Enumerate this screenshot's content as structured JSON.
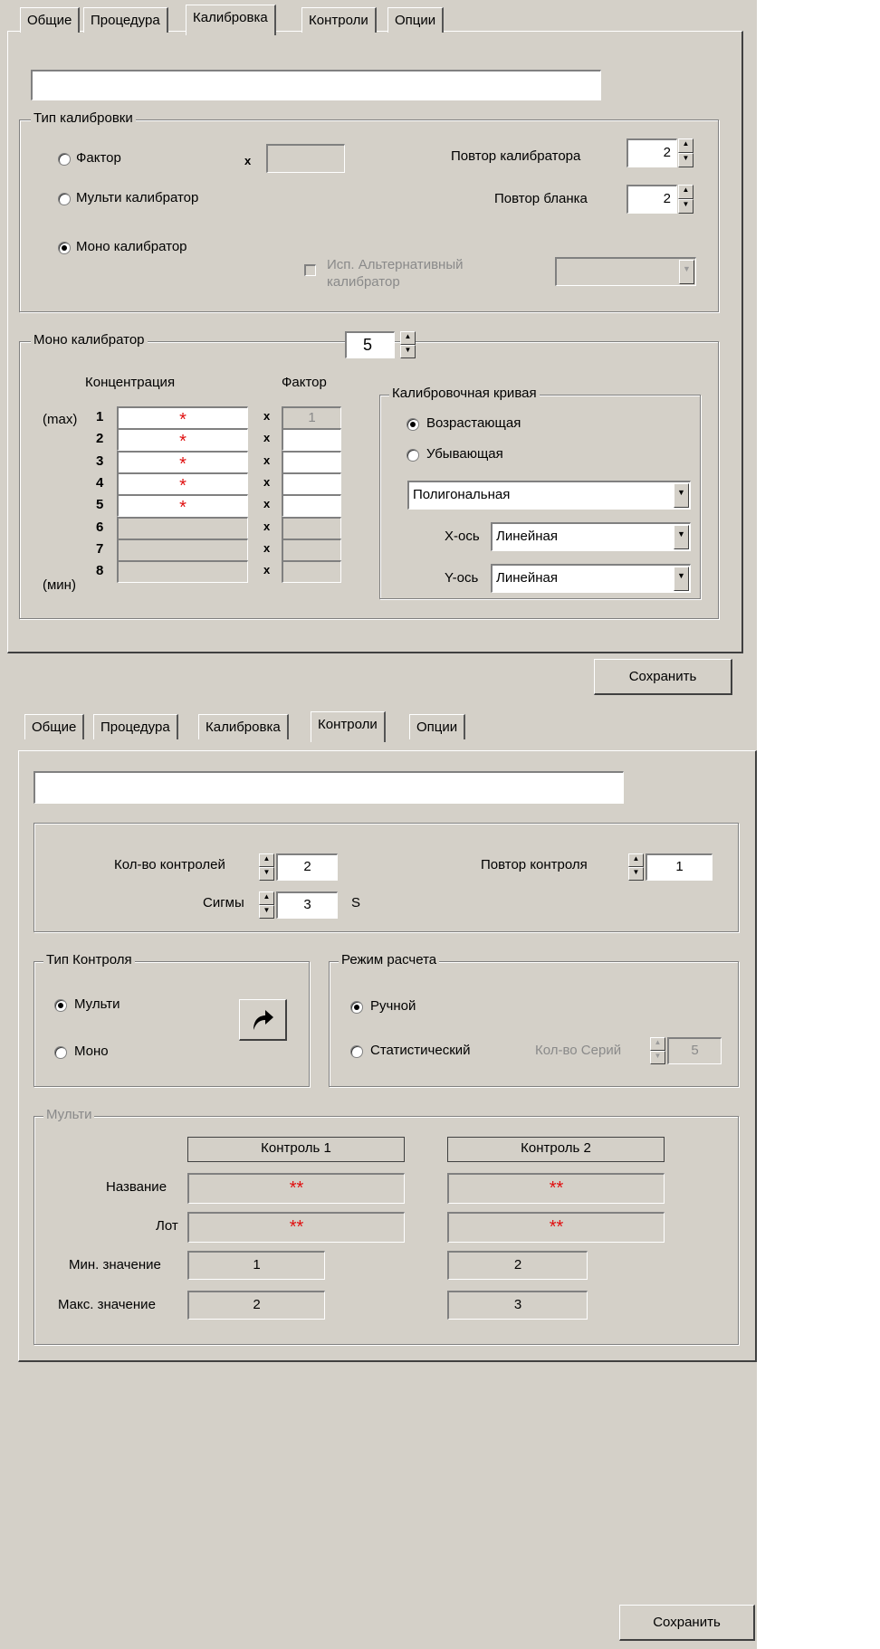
{
  "tabs": [
    "Общие",
    "Процедура",
    "Калибровка",
    "Контроли",
    "Опции"
  ],
  "calib": {
    "active_tab": "Калибровка",
    "name_value": "",
    "type_group": {
      "legend": "Тип калибровки",
      "options": [
        "Фактор",
        "Мульти калибратор",
        "Моно калибратор"
      ],
      "selected": "Моно калибратор",
      "factor_x": "x",
      "factor_value": "",
      "calib_repeat_label": "Повтор калибратора",
      "calib_repeat_value": "2",
      "blank_repeat_label": "Повтор бланка",
      "blank_repeat_value": "2",
      "alt_label_1": "Исп. Альтернативный",
      "alt_label_2": "калибратор",
      "alt_checked": false
    },
    "mono": {
      "legend": "Моно калибратор",
      "count": "5",
      "conc_header": "Концентрация",
      "factor_header": "Фактор",
      "max_label": "(max)",
      "min_label": "(мин)",
      "rows": [
        {
          "n": "1",
          "conc": "*",
          "factor": "1"
        },
        {
          "n": "2",
          "conc": "*",
          "factor": ""
        },
        {
          "n": "3",
          "conc": "*",
          "factor": ""
        },
        {
          "n": "4",
          "conc": "*",
          "factor": ""
        },
        {
          "n": "5",
          "conc": "*",
          "factor": ""
        },
        {
          "n": "6",
          "conc": "",
          "factor": ""
        },
        {
          "n": "7",
          "conc": "",
          "factor": ""
        },
        {
          "n": "8",
          "conc": "",
          "factor": ""
        }
      ],
      "x_mark": "x"
    },
    "curve": {
      "legend": "Калибровочная кривая",
      "options": [
        "Возрастающая",
        "Убывающая"
      ],
      "selected": "Возрастающая",
      "type_value": "Полигональная",
      "x_label": "X-ось",
      "x_value": "Линейная",
      "y_label": "Y-ось",
      "y_value": "Линейная"
    },
    "save_label": "Сохранить"
  },
  "controls": {
    "active_tab": "Контроли",
    "name_value": "",
    "count_label": "Кол-во контролей",
    "count_value": "2",
    "repeat_label": "Повтор контроля",
    "repeat_value": "1",
    "sigma_label": "Сигмы",
    "sigma_value": "3",
    "sigma_unit": "S",
    "type_group": {
      "legend": "Тип Контроля",
      "options": [
        "Мульти",
        "Моно"
      ],
      "selected": "Мульти"
    },
    "calc_group": {
      "legend": "Режим расчета",
      "options": [
        "Ручной",
        "Статистический"
      ],
      "selected": "Ручной",
      "series_label": "Кол-во Серий",
      "series_value": "5"
    },
    "multi": {
      "legend": "Мульти",
      "headers": [
        "Контроль 1",
        "Контроль 2"
      ],
      "name_label": "Название",
      "lot_label": "Лот",
      "min_label": "Мин. значение",
      "max_label": "Макс. значение",
      "names": [
        "**",
        "**"
      ],
      "lots": [
        "**",
        "**"
      ],
      "mins": [
        "1",
        "2"
      ],
      "maxs": [
        "2",
        "3"
      ]
    },
    "save_label": "Сохранить"
  }
}
